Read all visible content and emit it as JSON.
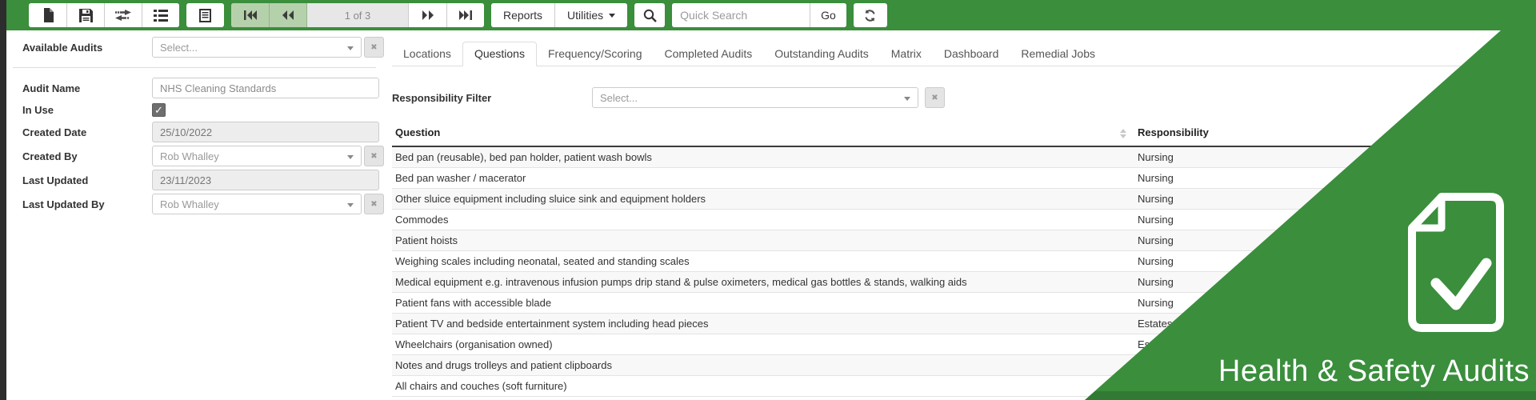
{
  "toolbar": {
    "icon_buttons": [
      "new-record",
      "save",
      "transfer",
      "list",
      "form",
      "first-page",
      "previous-page",
      "next-page",
      "last-page",
      "search",
      "refresh"
    ],
    "page_indicator": "1 of 3",
    "reports_label": "Reports",
    "utilities_label": "Utilities",
    "quick_search_placeholder": "Quick Search",
    "go_label": "Go"
  },
  "icons": {
    "clear": "✖",
    "check": "✓"
  },
  "sidebar": {
    "available_audits": {
      "label": "Available Audits",
      "placeholder": "Select..."
    },
    "audit_name": {
      "label": "Audit Name",
      "value": "NHS Cleaning Standards"
    },
    "in_use": {
      "label": "In Use",
      "checked": true
    },
    "created_date": {
      "label": "Created Date",
      "value": "25/10/2022"
    },
    "created_by": {
      "label": "Created By",
      "value": "Rob Whalley"
    },
    "last_updated": {
      "label": "Last Updated",
      "value": "23/11/2023"
    },
    "last_updated_by": {
      "label": "Last Updated By",
      "value": "Rob Whalley"
    }
  },
  "tabs": {
    "active": "Questions",
    "items": [
      {
        "label": "Locations"
      },
      {
        "label": "Questions"
      },
      {
        "label": "Frequency/Scoring"
      },
      {
        "label": "Completed Audits"
      },
      {
        "label": "Outstanding Audits"
      },
      {
        "label": "Matrix"
      },
      {
        "label": "Dashboard"
      },
      {
        "label": "Remedial Jobs"
      }
    ]
  },
  "filter": {
    "label": "Responsibility Filter",
    "placeholder": "Select..."
  },
  "table": {
    "columns": [
      "Question",
      "Responsibility"
    ],
    "rows": [
      {
        "question": "Bed pan (reusable), bed pan holder, patient wash bowls",
        "responsibility": "Nursing"
      },
      {
        "question": "Bed pan washer / macerator",
        "responsibility": "Nursing"
      },
      {
        "question": "Other sluice equipment including sluice sink and equipment holders",
        "responsibility": "Nursing"
      },
      {
        "question": "Commodes",
        "responsibility": "Nursing"
      },
      {
        "question": "Patient hoists",
        "responsibility": "Nursing"
      },
      {
        "question": "Weighing scales including neonatal, seated and standing scales",
        "responsibility": "Nursing"
      },
      {
        "question": "Medical equipment e.g. intravenous infusion pumps drip stand & pulse oximeters, medical gas bottles & stands, walking aids",
        "responsibility": "Nursing"
      },
      {
        "question": "Patient fans with accessible blade",
        "responsibility": "Nursing"
      },
      {
        "question": "Patient TV and bedside entertainment system including head pieces",
        "responsibility": "Estates"
      },
      {
        "question": "Wheelchairs (organisation owned)",
        "responsibility": "Estates"
      },
      {
        "question": "Notes and drugs trolleys and patient clipboards",
        "responsibility": ""
      },
      {
        "question": "All chairs and couches (soft furniture)",
        "responsibility": ""
      }
    ]
  },
  "overlay": {
    "title": "Health & Safety Audits",
    "green": "#3a8e3c"
  }
}
